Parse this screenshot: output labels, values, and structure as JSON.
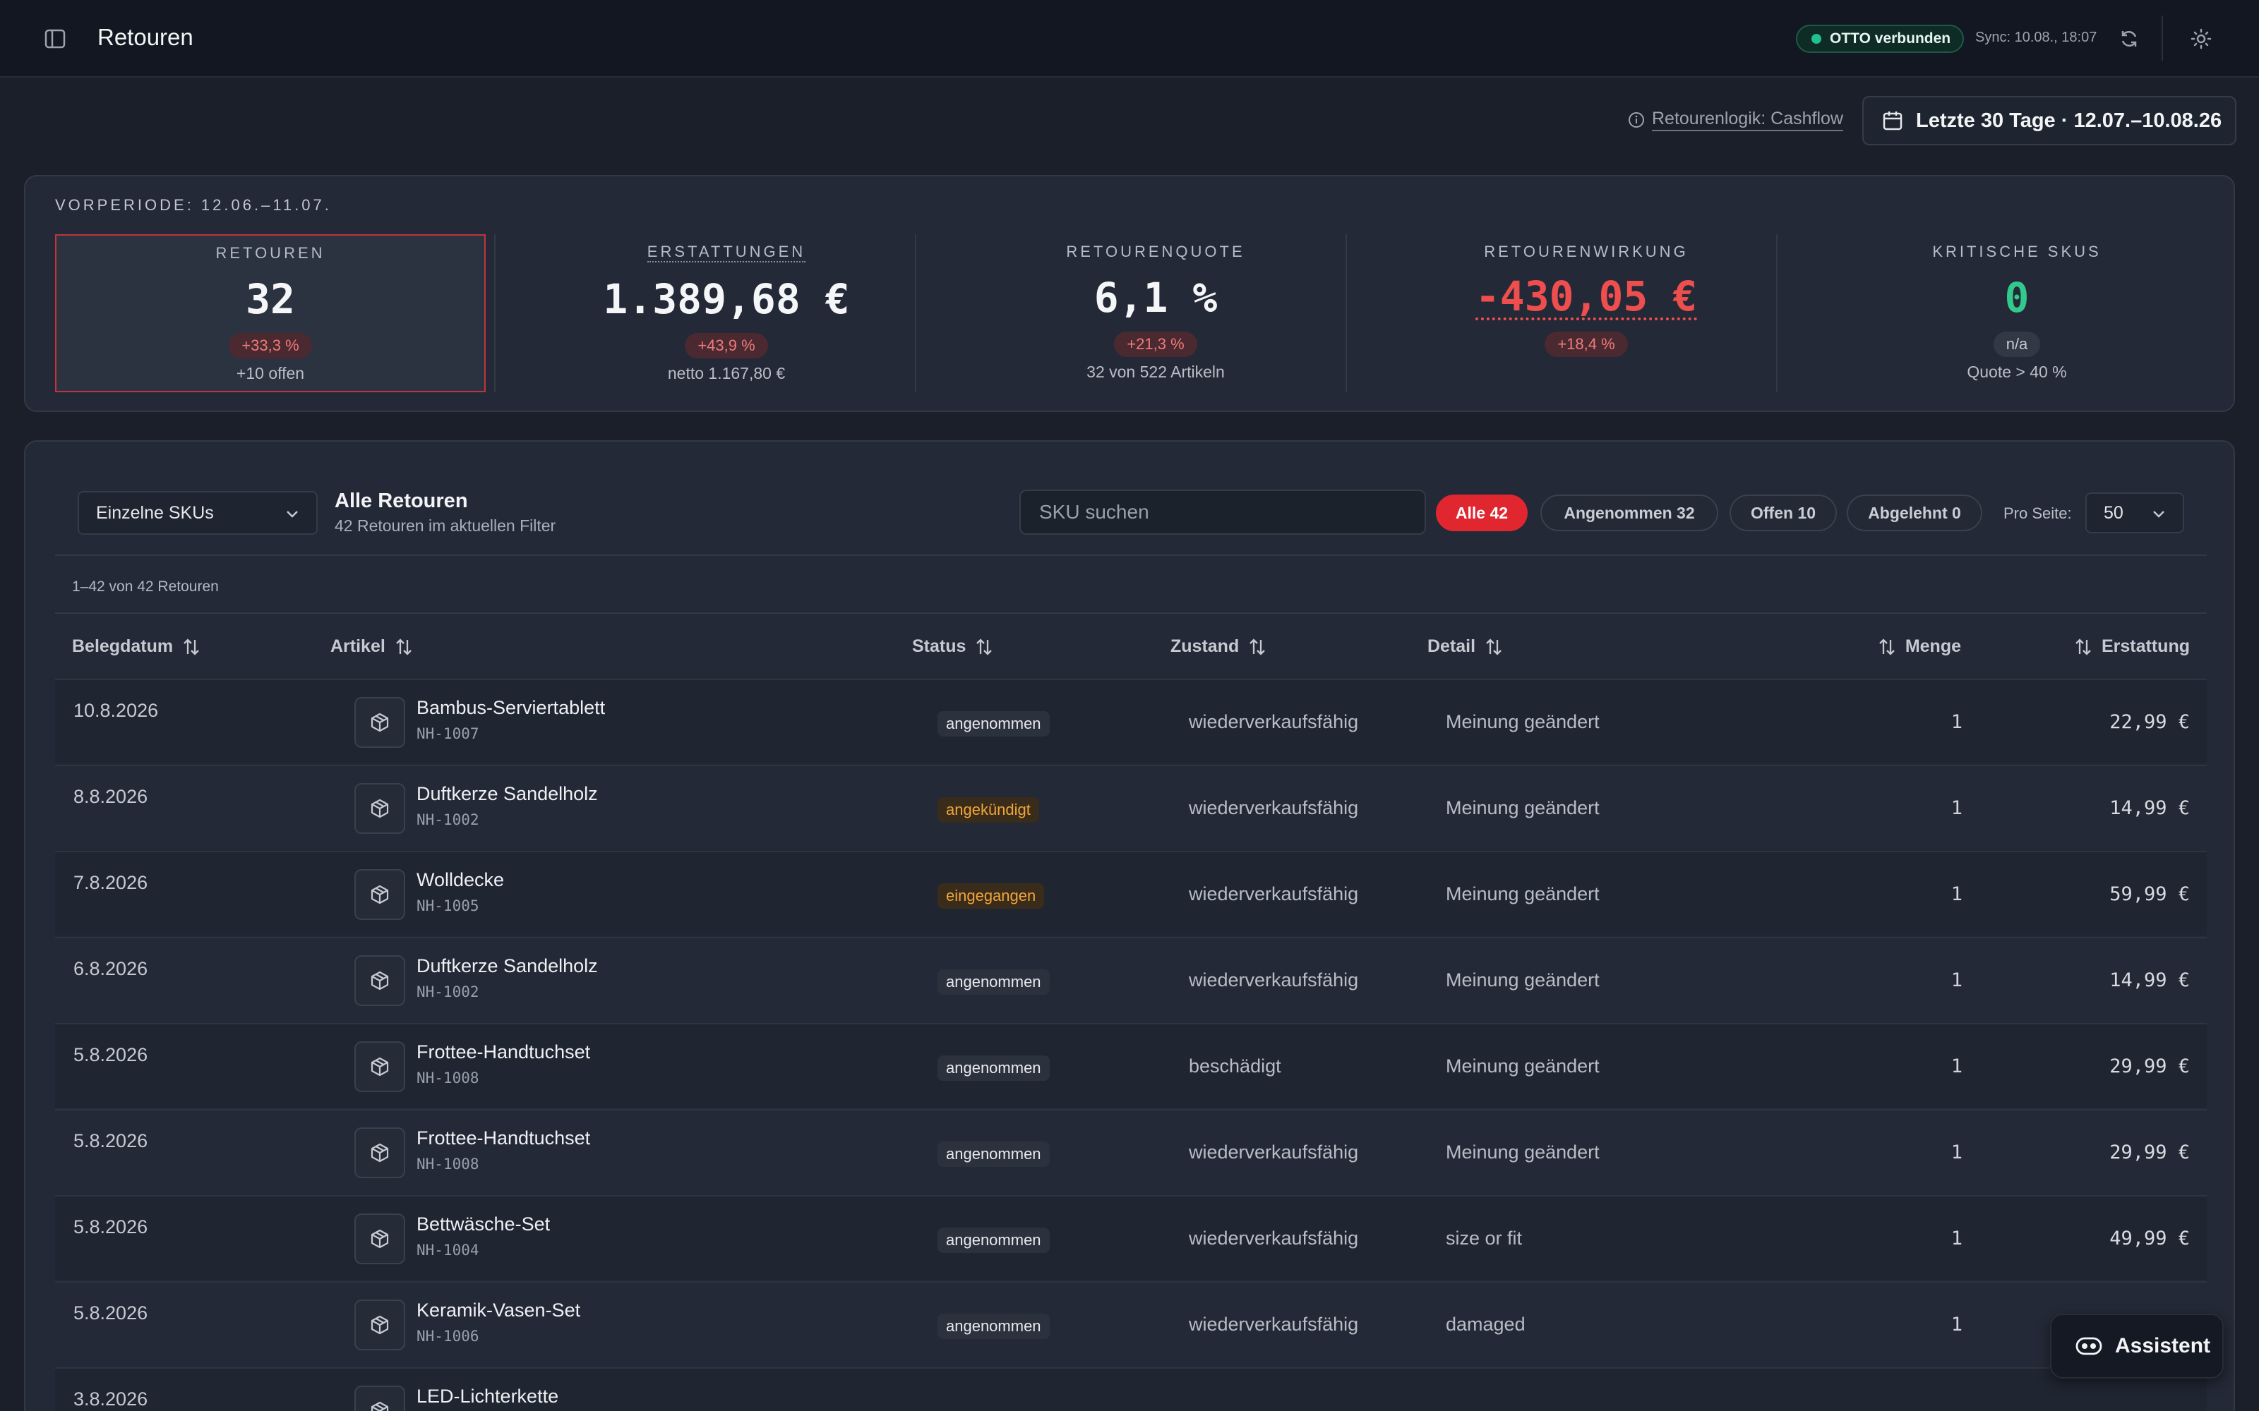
{
  "colors": {
    "background": "#1a1f2a",
    "accent_red": "#e0262f",
    "negative": "#ef4e4e",
    "positive": "#34c98c",
    "warning": "#f0a53a",
    "connected": "#22c08a"
  },
  "header": {
    "sidebar_toggle_icon": "sidebar-icon",
    "title": "Retouren",
    "connection_badge": "OTTO verbunden",
    "sync_text": "Sync: 10.08., 18:07",
    "refresh_icon": "refresh-icon",
    "theme_icon": "sun-icon"
  },
  "filters": {
    "logic_link": "Retourenlogik: Cashflow",
    "date_range": "Letzte 30 Tage · 12.07.–10.08.26"
  },
  "kpis": {
    "previous_period": "VORPERIODE: 12.06.–11.07.",
    "items": [
      {
        "label": "Retouren",
        "value": "32",
        "delta": "+33,3 %",
        "sub": "+10 offen"
      },
      {
        "label": "Erstattungen",
        "value": "1.389,68 €",
        "delta": "+43,9 %",
        "sub": "netto 1.167,80 €"
      },
      {
        "label": "Retourenquote",
        "value": "6,1 %",
        "delta": "+21,3 %",
        "sub": "32 von 522 Artikeln"
      },
      {
        "label": "Retourenwirkung",
        "value": "-430,05 €",
        "delta": "+18,4 %",
        "sub": ""
      },
      {
        "label": "Kritische SKUs",
        "value": "0",
        "delta": "n/a",
        "sub": "Quote > 40 %"
      }
    ]
  },
  "table": {
    "view_select": "Einzelne SKUs",
    "title": "Alle Retouren",
    "subtitle": "42 Retouren im aktuellen Filter",
    "search_placeholder": "SKU suchen",
    "pills": {
      "all": "Alle 42",
      "accepted": "Angenommen 32",
      "open": "Offen 10",
      "rejected": "Abgelehnt 0"
    },
    "per_page_label": "Pro Seite:",
    "per_page_value": "50",
    "range_text": "1–42 von 42 Retouren",
    "columns": {
      "date": "Belegdatum",
      "article": "Artikel",
      "status": "Status",
      "condition": "Zustand",
      "detail": "Detail",
      "quantity": "Menge",
      "refund": "Erstattung"
    },
    "rows": [
      {
        "date": "10.8.2026",
        "name": "Bambus-Serviertablett",
        "sku": "NH-1007",
        "status": "angenommen",
        "status_kind": "s-angenommen",
        "condition": "wiederverkaufsfähig",
        "detail": "Meinung geändert",
        "qty": "1",
        "refund": "22,99 €"
      },
      {
        "date": "8.8.2026",
        "name": "Duftkerze Sandelholz",
        "sku": "NH-1002",
        "status": "angekündigt",
        "status_kind": "s-angekuendigt",
        "condition": "wiederverkaufsfähig",
        "detail": "Meinung geändert",
        "qty": "1",
        "refund": "14,99 €"
      },
      {
        "date": "7.8.2026",
        "name": "Wolldecke",
        "sku": "NH-1005",
        "status": "eingegangen",
        "status_kind": "s-eingegangen",
        "condition": "wiederverkaufsfähig",
        "detail": "Meinung geändert",
        "qty": "1",
        "refund": "59,99 €"
      },
      {
        "date": "6.8.2026",
        "name": "Duftkerze Sandelholz",
        "sku": "NH-1002",
        "status": "angenommen",
        "status_kind": "s-angenommen",
        "condition": "wiederverkaufsfähig",
        "detail": "Meinung geändert",
        "qty": "1",
        "refund": "14,99 €"
      },
      {
        "date": "5.8.2026",
        "name": "Frottee-Handtuchset",
        "sku": "NH-1008",
        "status": "angenommen",
        "status_kind": "s-angenommen",
        "condition": "beschädigt",
        "detail": "Meinung geändert",
        "qty": "1",
        "refund": "29,99 €"
      },
      {
        "date": "5.8.2026",
        "name": "Frottee-Handtuchset",
        "sku": "NH-1008",
        "status": "angenommen",
        "status_kind": "s-angenommen",
        "condition": "wiederverkaufsfähig",
        "detail": "Meinung geändert",
        "qty": "1",
        "refund": "29,99 €"
      },
      {
        "date": "5.8.2026",
        "name": "Bettwäsche-Set",
        "sku": "NH-1004",
        "status": "angenommen",
        "status_kind": "s-angenommen",
        "condition": "wiederverkaufsfähig",
        "detail": "size or fit",
        "qty": "1",
        "refund": "49,99 €"
      },
      {
        "date": "5.8.2026",
        "name": "Keramik-Vasen-Set",
        "sku": "NH-1006",
        "status": "angenommen",
        "status_kind": "s-angenommen",
        "condition": "wiederverkaufsfähig",
        "detail": "damaged",
        "qty": "1",
        "refund": ""
      },
      {
        "date": "3.8.2026",
        "name": "LED-Lichterkette",
        "sku": "",
        "status": "",
        "status_kind": "",
        "condition": "",
        "detail": "",
        "qty": "",
        "refund": ""
      }
    ]
  },
  "assistant": {
    "label": "Assistent",
    "icon": "assistant-icon"
  }
}
